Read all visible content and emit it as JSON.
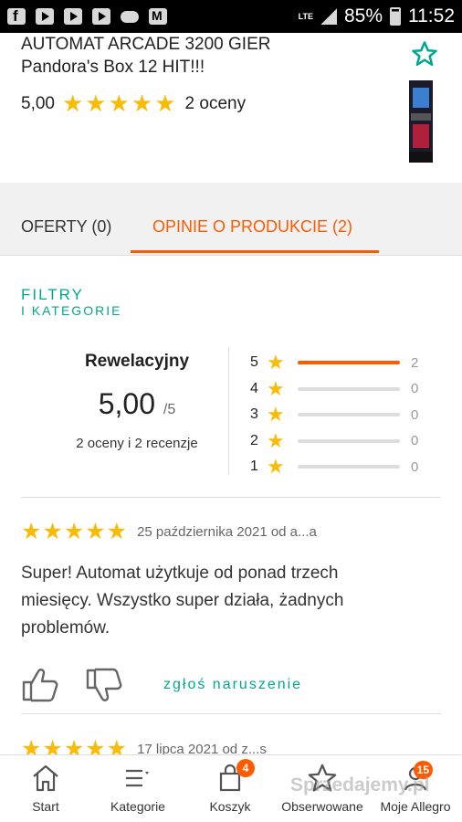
{
  "statusbar": {
    "app_icons": [
      "facebook-icon",
      "youtube-icon",
      "youtube-icon",
      "youtube-icon",
      "cloud-icon",
      "gmail-icon"
    ],
    "network": "LTE",
    "battery": "85%",
    "time": "11:52"
  },
  "product": {
    "title_line1": "AUTOMAT ARCADE 3200 GIER",
    "title_line2": "Pandora's Box 12 HIT!!!",
    "rating_value": "5,00",
    "rating_stars": "★★★★★",
    "rating_count": "2 oceny",
    "favorite_icon": "star-outline-icon"
  },
  "tabs": {
    "offers": "OFERTY (0)",
    "reviews": "OPINIE O PRODUKCIE (2)",
    "active": "reviews"
  },
  "filters": {
    "line1": "FILTRY",
    "line2": "I KATEGORIE"
  },
  "summary": {
    "label": "Rewelacyjny",
    "score": "5,00",
    "score_max": "/5",
    "counts": "2 oceny i 2 recenzje",
    "bars": [
      {
        "stars": "5",
        "count": "2",
        "fraction": 1.0
      },
      {
        "stars": "4",
        "count": "0",
        "fraction": 0
      },
      {
        "stars": "3",
        "count": "0",
        "fraction": 0
      },
      {
        "stars": "2",
        "count": "0",
        "fraction": 0
      },
      {
        "stars": "1",
        "count": "0",
        "fraction": 0
      }
    ]
  },
  "reviews": [
    {
      "stars": "★★★★★",
      "meta": "25 października 2021 od a...a",
      "text": "Super! Automat użytkuje od ponad trzech miesięcy. Wszystko super działa, żadnych problemów.",
      "report": "zgłoś naruszenie"
    },
    {
      "stars": "★★★★★",
      "meta": "17 lipca 2021 od z...s"
    }
  ],
  "bottomnav": {
    "items": [
      {
        "label": "Start",
        "icon": "home-icon"
      },
      {
        "label": "Kategorie",
        "icon": "menu-icon"
      },
      {
        "label": "Koszyk",
        "icon": "cart-icon",
        "badge": "4"
      },
      {
        "label": "Obserwowane",
        "icon": "star-icon"
      },
      {
        "label": "Moje Allegro",
        "icon": "user-icon",
        "badge": "15"
      }
    ]
  },
  "watermark": "Sprzedajemy.pl",
  "colors": {
    "accent_orange": "#ff5a00",
    "accent_teal": "#00a790",
    "star_yellow": "#f8bb08"
  }
}
